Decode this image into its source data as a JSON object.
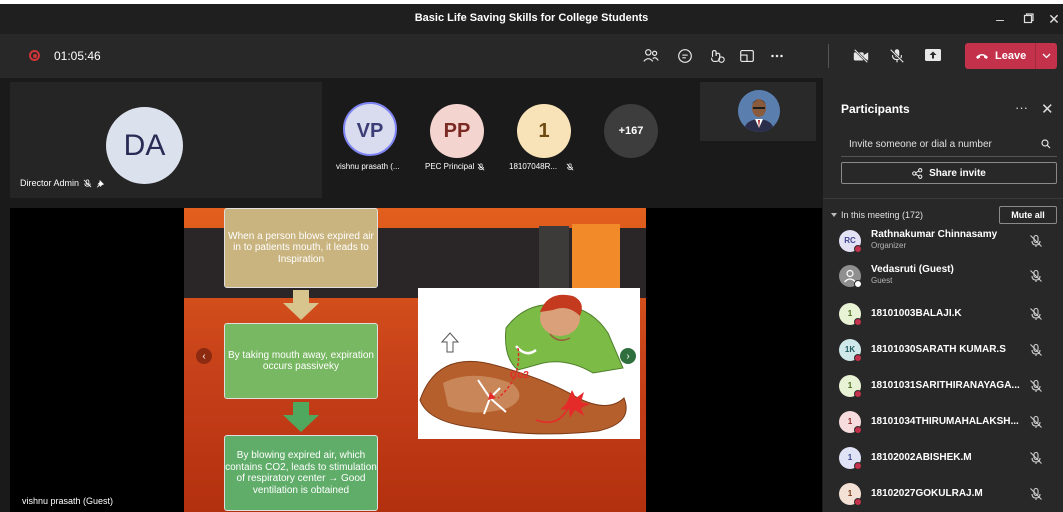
{
  "window": {
    "title": "Basic Life Saving Skills for College Students",
    "minimize_icon": "minimize-icon",
    "maximize_icon": "restore-icon",
    "close_icon": "close-icon"
  },
  "toolbar": {
    "timer": "01:05:46",
    "leave_label": "Leave",
    "colors": {
      "leave": "#c4314b",
      "recording": "#d13438"
    },
    "icons": [
      "participants-icon",
      "chat-icon",
      "reactions-icon",
      "rooms-icon",
      "more-icon",
      "camera-off-icon",
      "mic-off-icon",
      "share-tray-icon"
    ]
  },
  "stage": {
    "main_tile": {
      "initials": "DA",
      "name": "Director Admin"
    },
    "gallery": [
      {
        "initials": "VP",
        "name": "vishnu prasath (...",
        "bg": "#d9dcee",
        "fg": "#3c3d77"
      },
      {
        "initials": "PP",
        "name": "PEC Principal",
        "bg": "#f3d4cf",
        "fg": "#7a2a22"
      },
      {
        "initials": "1",
        "name": "18107048R...",
        "bg": "#f8e3b8",
        "fg": "#6d4a10"
      },
      {
        "initials": "+167",
        "name": "",
        "bg": "#3d3d3d",
        "fg": "#ffffff"
      }
    ],
    "presenter": "vishnu prasath (Guest)",
    "slide": {
      "box1": "When a person blows expired air in to patients mouth, it leads to Inspiration",
      "box2": "By taking mouth away, expiration occurs passiveky",
      "box3": "By blowing expired air, which contains CO2, leads to stimulation of respiratory center → Good ventilation is obtained",
      "figure_label": "Co2"
    }
  },
  "panel": {
    "title": "Participants",
    "search_placeholder": "Invite someone or dial a number",
    "share_label": "Share invite",
    "section_label": "In this meeting (172)",
    "mute_all_label": "Mute all",
    "participants": [
      {
        "initials": "RC",
        "name": "Rathnakumar Chinnasamy",
        "role": "Organizer",
        "bg": "#e3e1f4",
        "fg": "#444791"
      },
      {
        "initials": "",
        "name": "Vedasruti (Guest)",
        "role": "Guest",
        "bg": "#8f8f8f",
        "fg": "#ffffff"
      },
      {
        "initials": "1",
        "name": "18101003BALAJI.K",
        "role": "",
        "bg": "#e8f2d4",
        "fg": "#4a6b1d"
      },
      {
        "initials": "1K",
        "name": "18101030SARATH KUMAR.S",
        "role": "",
        "bg": "#cfe9ea",
        "fg": "#205b5e"
      },
      {
        "initials": "1",
        "name": "18101031SARITHIRANAYAGA...",
        "role": "",
        "bg": "#e8f2d4",
        "fg": "#4a6b1d"
      },
      {
        "initials": "1",
        "name": "18101034THIRUMAHALAKSH...",
        "role": "",
        "bg": "#f6dcdc",
        "fg": "#8a2a2a"
      },
      {
        "initials": "1",
        "name": "18102002ABISHEK.M",
        "role": "",
        "bg": "#dfe3f5",
        "fg": "#3a4690"
      },
      {
        "initials": "1",
        "name": "18102027GOKULRAJ.M",
        "role": "",
        "bg": "#f3e1d6",
        "fg": "#7a3c1a"
      }
    ]
  }
}
